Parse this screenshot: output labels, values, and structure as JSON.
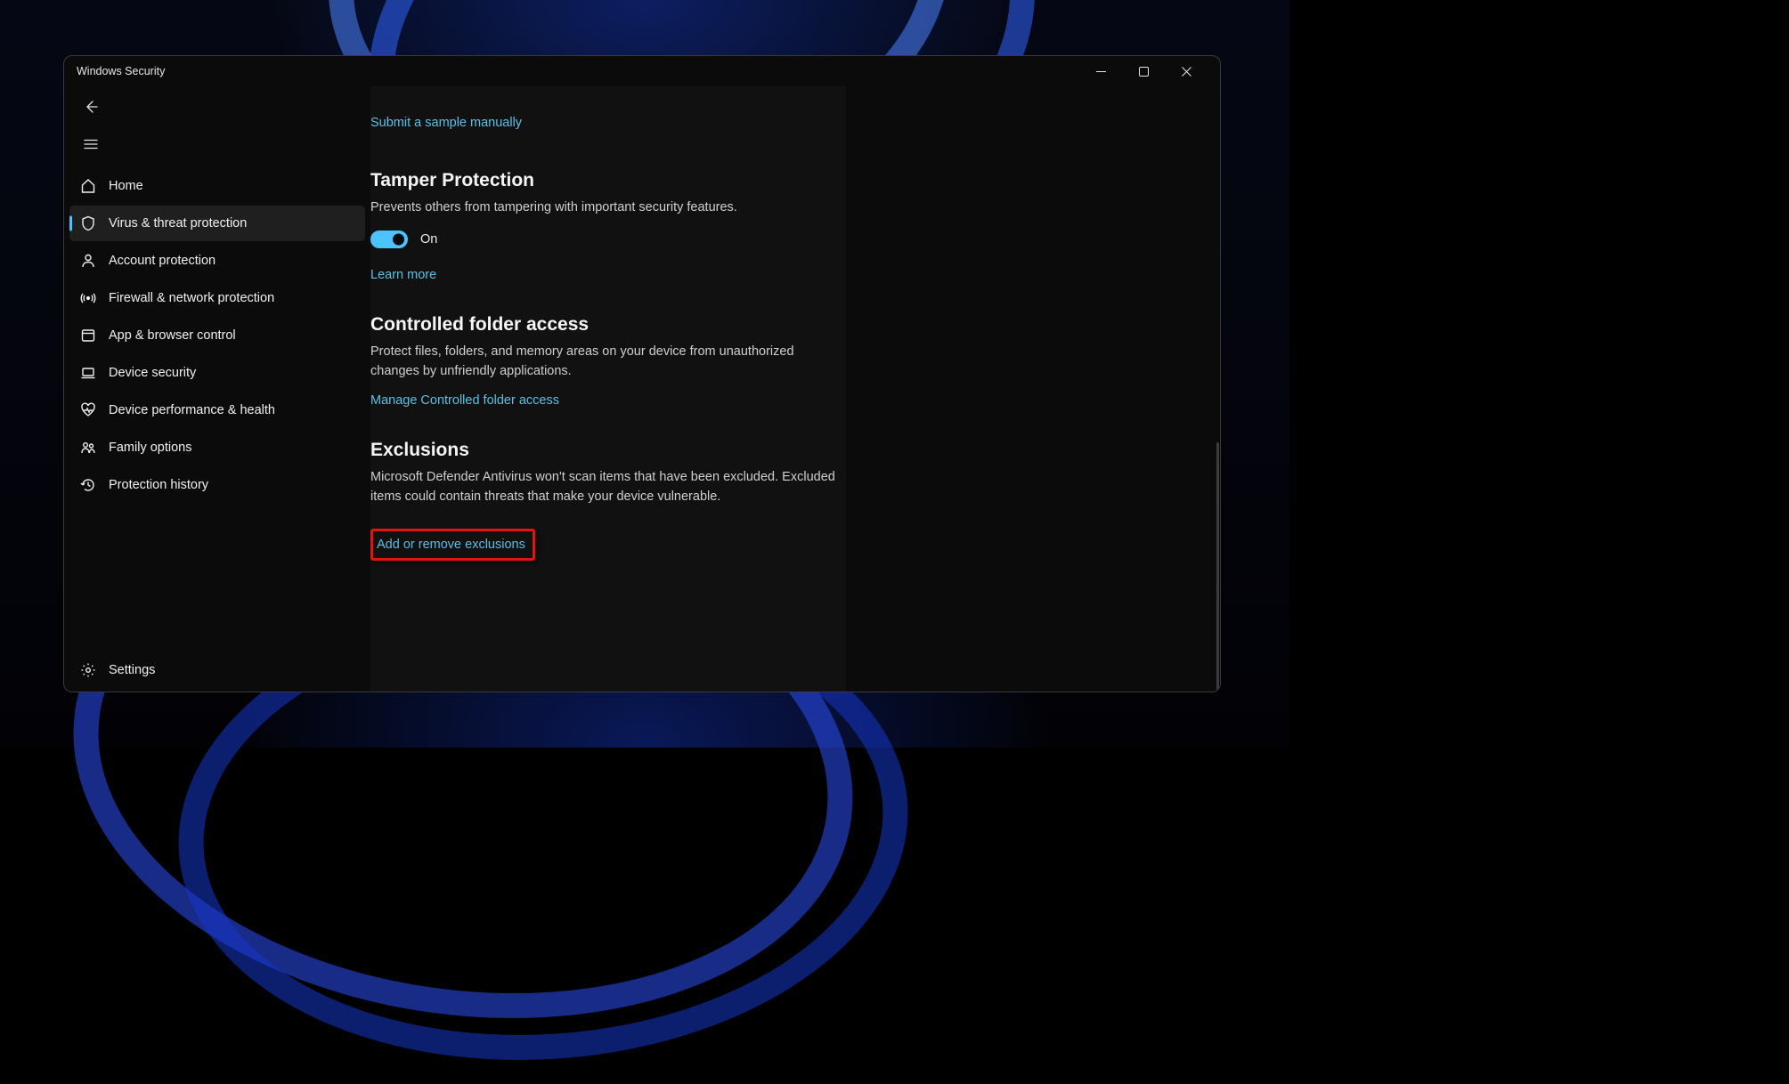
{
  "window": {
    "title": "Windows Security"
  },
  "nav": {
    "items": [
      {
        "label": "Home"
      },
      {
        "label": "Virus & threat protection"
      },
      {
        "label": "Account protection"
      },
      {
        "label": "Firewall & network protection"
      },
      {
        "label": "App & browser control"
      },
      {
        "label": "Device security"
      },
      {
        "label": "Device performance & health"
      },
      {
        "label": "Family options"
      },
      {
        "label": "Protection history"
      }
    ],
    "settings_label": "Settings"
  },
  "content": {
    "submit_sample_link": "Submit a sample manually",
    "tamper": {
      "title": "Tamper Protection",
      "desc": "Prevents others from tampering with important security features.",
      "toggle_state_label": "On",
      "learn_more": "Learn more"
    },
    "cfa": {
      "title": "Controlled folder access",
      "desc": "Protect files, folders, and memory areas on your device from unauthorized changes by unfriendly applications.",
      "manage_link": "Manage Controlled folder access"
    },
    "exclusions": {
      "title": "Exclusions",
      "desc": "Microsoft Defender Antivirus won't scan items that have been excluded. Excluded items could contain threats that make your device vulnerable.",
      "add_remove_link": "Add or remove exclusions"
    }
  }
}
